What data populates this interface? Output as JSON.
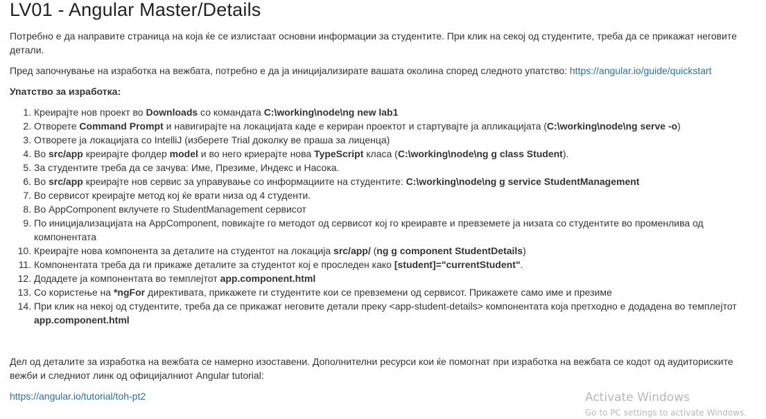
{
  "title": "LV01 - Angular Master/Details",
  "intro": "Потребно е да направите страница на која ќе се излистаат основни информации за студентите. При клик на секој од студентите, треба да се прикажат неговите детали.",
  "setup": {
    "text": "Пред започнување на изработка на вежбата, потребно е да ја иницијализирате вашата околина според следното упатство: ",
    "link": "https://angular.io/guide/quickstart"
  },
  "instructions_heading": "Упатство за изработка:",
  "steps": [
    [
      {
        "t": "Креирајте нов проект во "
      },
      {
        "t": "Downloads",
        "b": true
      },
      {
        "t": " со командата "
      },
      {
        "t": "C:\\working\\node\\ng new lab1",
        "b": true
      }
    ],
    [
      {
        "t": "Отворете "
      },
      {
        "t": "Command Prompt",
        "b": true
      },
      {
        "t": " и навигирајте на локацијата каде е кериран проектот и стартувајте ја апликацијата ("
      },
      {
        "t": "C:\\working\\node\\ng serve -o",
        "b": true
      },
      {
        "t": ")"
      }
    ],
    [
      {
        "t": "Отворете ја локацијата со IntelliJ (изберете Trial доколку ве праша за лиценца)"
      }
    ],
    [
      {
        "t": "Во "
      },
      {
        "t": "src/app",
        "b": true
      },
      {
        "t": " креирајте фолдер "
      },
      {
        "t": "model",
        "b": true
      },
      {
        "t": " и во него криерајте нова "
      },
      {
        "t": "TypeScript",
        "b": true
      },
      {
        "t": " класа ("
      },
      {
        "t": "C:\\working\\node\\ng g class Student",
        "b": true
      },
      {
        "t": ")."
      }
    ],
    [
      {
        "t": "За студентите треба да се зачува: Име, Презиме, Индекс и Насока."
      }
    ],
    [
      {
        "t": "Во "
      },
      {
        "t": "src/app",
        "b": true
      },
      {
        "t": " креирајте нов сервис за управување со информациите на студентите: "
      },
      {
        "t": "C:\\working\\node\\ng g service StudentManagement",
        "b": true
      }
    ],
    [
      {
        "t": "Во сервисот креирајте метод кој ќе врати низа од 4 студенти."
      }
    ],
    [
      {
        "t": "Во AppComponent вклучете го StudentManagement сервисот"
      }
    ],
    [
      {
        "t": "По иницијализацијата на AppComponent, повикајте го методот од сервисот кој го креиравте и превземете ја низата со студентите во променлива од компонентата"
      }
    ],
    [
      {
        "t": "Креирајте нова компонента за деталите на студентот на локација "
      },
      {
        "t": "src/app/",
        "b": true
      },
      {
        "t": " ("
      },
      {
        "t": "ng g component StudentDetails",
        "b": true
      },
      {
        "t": ")"
      }
    ],
    [
      {
        "t": "Компонентата треба да ги прикаже деталите за студентот кој е проследен како "
      },
      {
        "t": "[student]=\"currentStudent\"",
        "b": true
      },
      {
        "t": "."
      }
    ],
    [
      {
        "t": "Додадете ја компонентата во темплејтот "
      },
      {
        "t": "app.component.html",
        "b": true
      }
    ],
    [
      {
        "t": "Со користење на "
      },
      {
        "t": "*ngFor",
        "b": true
      },
      {
        "t": " директивата, прикажете ги студентите кои се превземени од сервисот. Прикажете само име и презиме"
      }
    ],
    [
      {
        "t": "При клик на некој од студентите, треба да се прикажат неговите детали преку <app-student-details> компонентата која претходно е додадена во темплејтот "
      },
      {
        "t": "app.component.html",
        "b": true
      }
    ]
  ],
  "outro": "Дел од деталите за изработка на вежбата се намерно изоставени. Дополнителни ресурси кои ќе помогнат при изработка на вежбата се кодот од аудиториските вежби и следниот линк од официјалниот Angular tutorial:",
  "tutorial_link": "https://angular.io/tutorial/toh-pt2",
  "watermark": {
    "title": "Activate Windows",
    "subtitle": "Go to PC settings to activate Windows."
  }
}
